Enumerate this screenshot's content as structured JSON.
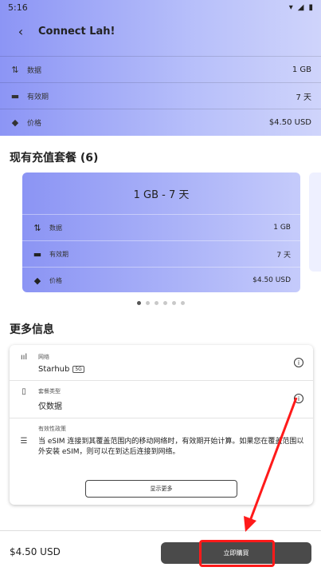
{
  "status": {
    "time": "5:16"
  },
  "header": {
    "title": "Connect Lah!"
  },
  "summary": [
    {
      "icon": "updown-arrows-icon",
      "label": "数据",
      "value": "1 GB"
    },
    {
      "icon": "calendar-icon",
      "label": "有效期",
      "value": "7 天"
    },
    {
      "icon": "tag-icon",
      "label": "价格",
      "value": "$4.50 USD"
    }
  ],
  "topup": {
    "title": "现有充值套餐 (6)",
    "card": {
      "plan": "1 GB - 7 天",
      "rows": [
        {
          "icon": "updown-arrows-icon",
          "label": "数据",
          "value": "1 GB"
        },
        {
          "icon": "calendar-icon",
          "label": "有效期",
          "value": "7 天"
        },
        {
          "icon": "tag-icon",
          "label": "价格",
          "value": "$4.50 USD"
        }
      ]
    },
    "dots_total": 6,
    "dots_active": 1
  },
  "info": {
    "title": "更多信息",
    "network_label": "网络",
    "network_value": "Starhub",
    "network_tag": "5G",
    "plan_type_label": "套餐类型",
    "plan_type_value": "仅数据",
    "policy_label": "有效性政策",
    "policy_value": "当 eSIM 连接到其覆盖范围内的移动网络时，有效期开始计算。如果您在覆盖范围以外安装 eSIM，则可以在到达后连接到网络。",
    "more_button": "显示更多"
  },
  "footer": {
    "price": "$4.50 USD",
    "buy_button": "立即購買"
  },
  "colors": {
    "accent_gradient_start": "#8c95f5",
    "highlight": "#ff1a1a",
    "button": "#4a4a4a"
  }
}
